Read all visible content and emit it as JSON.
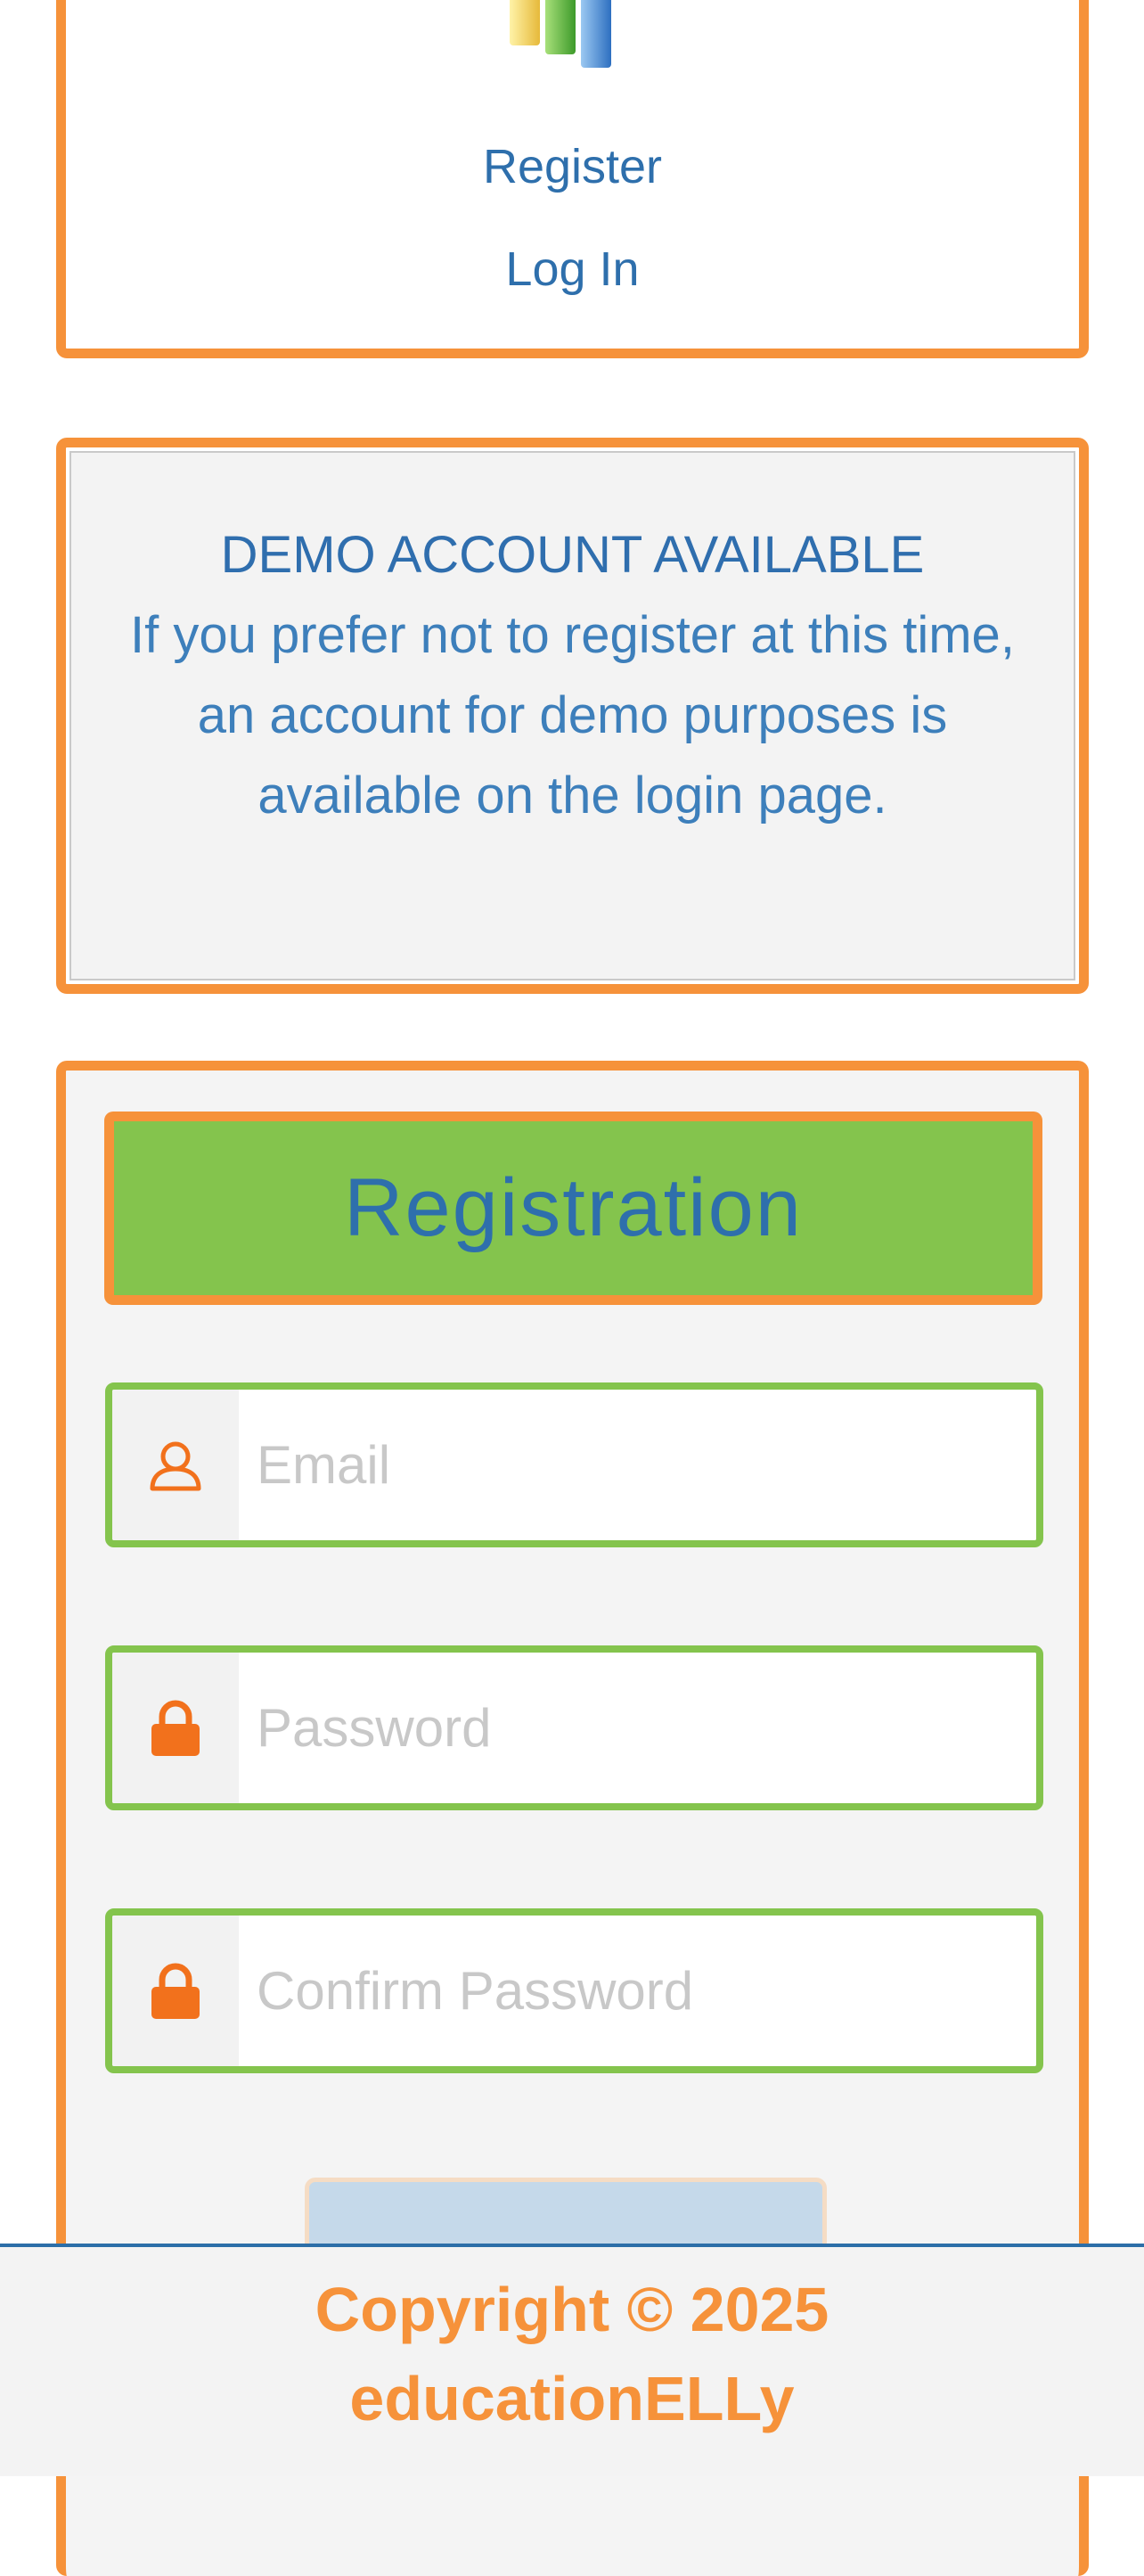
{
  "nav": {
    "register_label": "Register",
    "login_label": "Log In"
  },
  "demo": {
    "title": "DEMO ACCOUNT AVAILABLE",
    "body": "If you prefer not to register at this time, an account for demo purposes is available on the login page."
  },
  "registration": {
    "title": "Registration",
    "fields": [
      {
        "placeholder": "Email",
        "icon": "user-icon"
      },
      {
        "placeholder": "Password",
        "icon": "lock-icon"
      },
      {
        "placeholder": "Confirm Password",
        "icon": "lock-icon"
      }
    ]
  },
  "footer": {
    "copyright": "Copyright © 2025",
    "brand": "educationELLy"
  },
  "colors": {
    "accent_orange": "#f6923a",
    "header_green": "#84c44d",
    "link_blue": "#2e6fac"
  }
}
